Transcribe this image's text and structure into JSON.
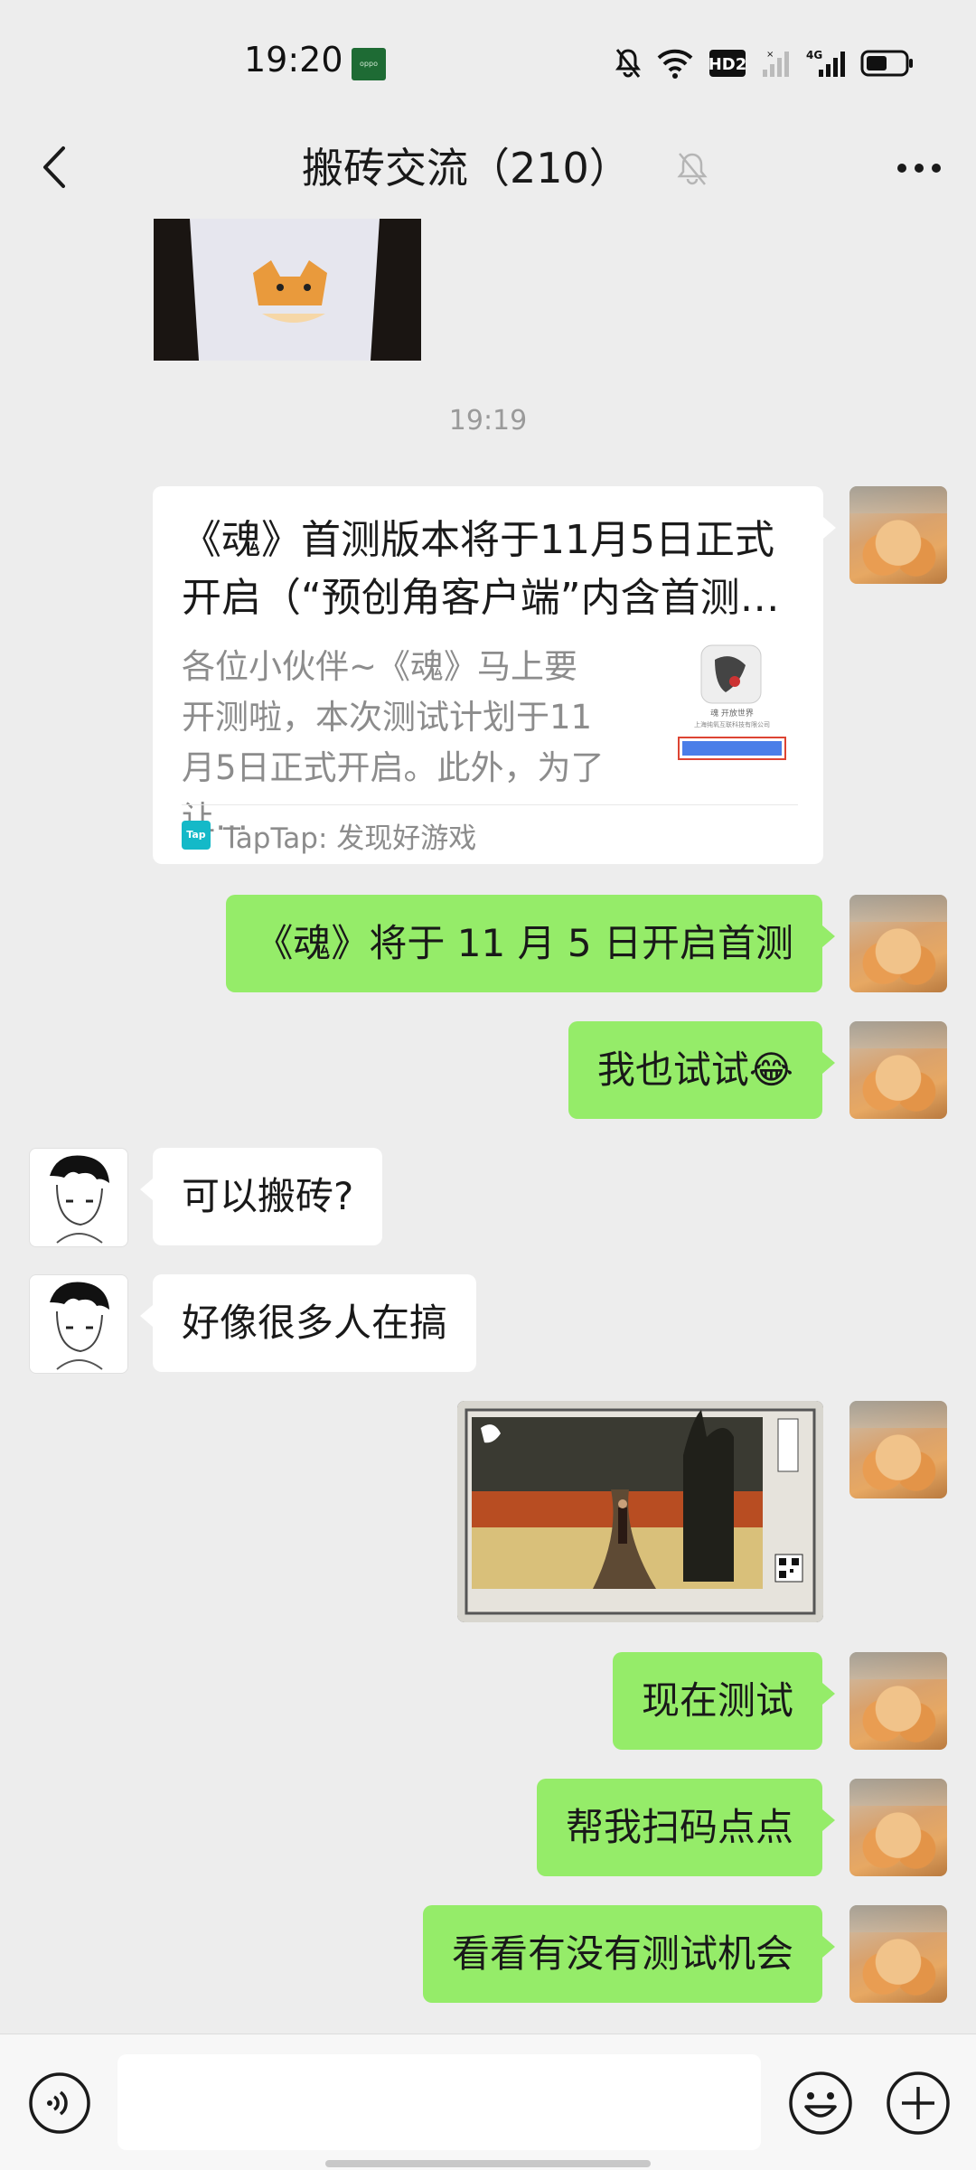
{
  "status_bar": {
    "time": "19:20",
    "carrier_logo": "oppo",
    "network": "HD2",
    "cellular": "4G"
  },
  "header": {
    "title": "搬砖交流（210）",
    "back_icon": "chevron-left-icon",
    "mute_icon": "bell-off-icon",
    "more_icon": "more-dots-icon"
  },
  "chat": {
    "timestamp": "19:19",
    "card": {
      "title": "《魂》首测版本将于11月5日正式开启（“预创角客户端”内含首测…",
      "description": "各位小伙伴~《魂》马上要开测啦，本次测试计划于11月5日正式开启。此外，为了让…",
      "thumb_text": "魂 开放世界",
      "thumb_company": "上海纯氧互联科技有限公司",
      "source": "TapTap: 发现好游戏",
      "source_logo": "Tap"
    },
    "messages": [
      {
        "side": "right",
        "text": "《魂》将于 11 月 5 日开启首测"
      },
      {
        "side": "right",
        "text": "我也试试😂"
      },
      {
        "side": "left",
        "text": "可以搬砖?"
      },
      {
        "side": "left",
        "text": "好像很多人在搞"
      },
      {
        "side": "right",
        "text": "现在测试"
      },
      {
        "side": "right",
        "text": "帮我扫码点点"
      },
      {
        "side": "right",
        "text": "看看有没有测试机会"
      }
    ]
  },
  "input_bar": {
    "placeholder": "",
    "voice_icon": "voice-icon",
    "emoji_icon": "emoji-icon",
    "plus_icon": "plus-icon"
  }
}
